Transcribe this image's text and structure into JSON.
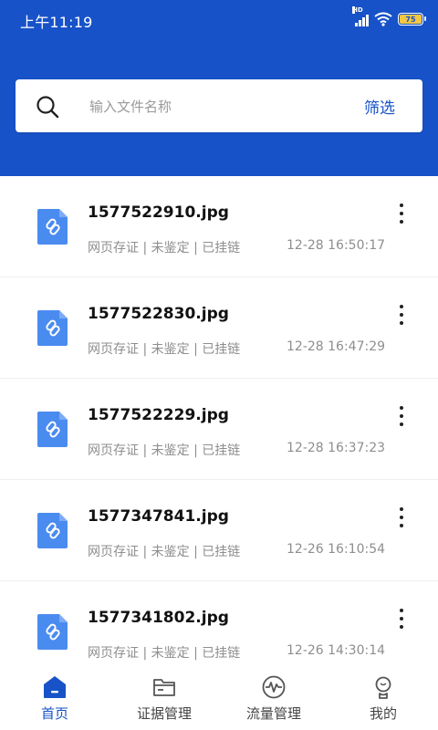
{
  "status_bar": {
    "time": "上午11:19",
    "signal_label": "HD",
    "battery": "75"
  },
  "search": {
    "placeholder": "输入文件名称",
    "filter_label": "筛选"
  },
  "files": [
    {
      "name": "1577522910.jpg",
      "meta": "网页存证 | 未鉴定 | 已挂链",
      "time": "12-28 16:50:17"
    },
    {
      "name": "1577522830.jpg",
      "meta": "网页存证 | 未鉴定 | 已挂链",
      "time": "12-28 16:47:29"
    },
    {
      "name": "1577522229.jpg",
      "meta": "网页存证 | 未鉴定 | 已挂链",
      "time": "12-28 16:37:23"
    },
    {
      "name": "1577347841.jpg",
      "meta": "网页存证 | 未鉴定 | 已挂链",
      "time": "12-26 16:10:54"
    },
    {
      "name": "1577341802.jpg",
      "meta": "网页存证 | 未鉴定 | 已挂链",
      "time": "12-26 14:30:14"
    }
  ],
  "nav": {
    "items": [
      {
        "label": "首页",
        "icon": "home-icon",
        "active": true
      },
      {
        "label": "证据管理",
        "icon": "folder-icon",
        "active": false
      },
      {
        "label": "流量管理",
        "icon": "pulse-icon",
        "active": false
      },
      {
        "label": "我的",
        "icon": "user-icon",
        "active": false
      }
    ]
  },
  "colors": {
    "primary": "#1752c8",
    "file_icon": "#4a8bf0",
    "battery_fill": "#f2c744"
  }
}
